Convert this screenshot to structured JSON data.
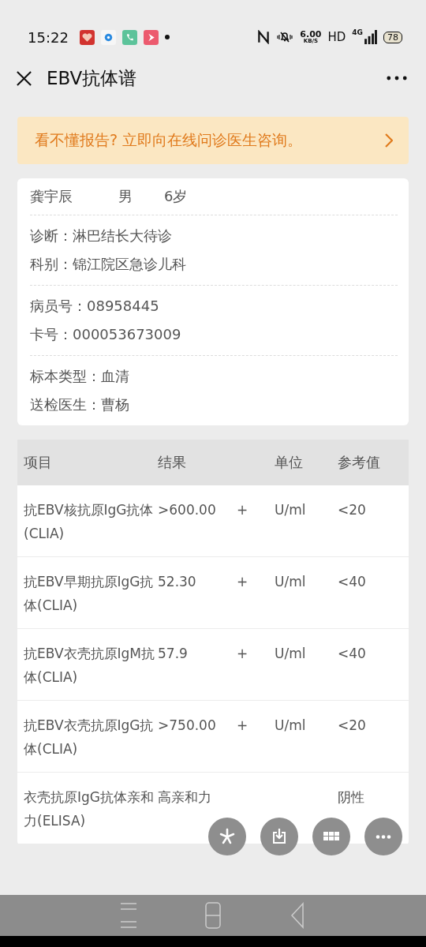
{
  "status_bar": {
    "time": "15:22",
    "speed": "6.00",
    "speed_unit": "KB/S",
    "hd": "HD",
    "network": "4G",
    "battery": "78"
  },
  "header": {
    "title": "EBV抗体谱"
  },
  "banner": {
    "text": "看不懂报告? 立即向在线问诊医生咨询。"
  },
  "patient": {
    "name": "龚宇辰",
    "sex": "男",
    "age": "6岁"
  },
  "info_groups": [
    [
      "诊断：淋巴结长大待诊",
      "科别：锦江院区急诊儿科"
    ],
    [
      "病员号：08958445",
      "卡号：000053673009"
    ],
    [
      "标本类型：血清",
      "送检医生：曹杨"
    ]
  ],
  "table": {
    "columns": [
      "项目",
      "结果",
      "单位",
      "参考值"
    ],
    "rows": [
      {
        "item": "抗EBV核抗原IgG抗体(CLIA)",
        "result": ">600.00",
        "flag": "+",
        "unit": "U/ml",
        "reference": "<20"
      },
      {
        "item": "抗EBV早期抗原IgG抗体(CLIA)",
        "result": "52.30",
        "flag": "+",
        "unit": "U/ml",
        "reference": "<40"
      },
      {
        "item": "抗EBV衣壳抗原IgM抗体(CLIA)",
        "result": "57.9",
        "flag": "+",
        "unit": "U/ml",
        "reference": "<40"
      },
      {
        "item": "抗EBV衣壳抗原IgG抗体(CLIA)",
        "result": ">750.00",
        "flag": "+",
        "unit": "U/ml",
        "reference": "<20"
      },
      {
        "item": "衣壳抗原IgG抗体亲和力(ELISA)",
        "result": "高亲和力",
        "flag": "",
        "unit": "",
        "reference": "阴性"
      }
    ]
  }
}
